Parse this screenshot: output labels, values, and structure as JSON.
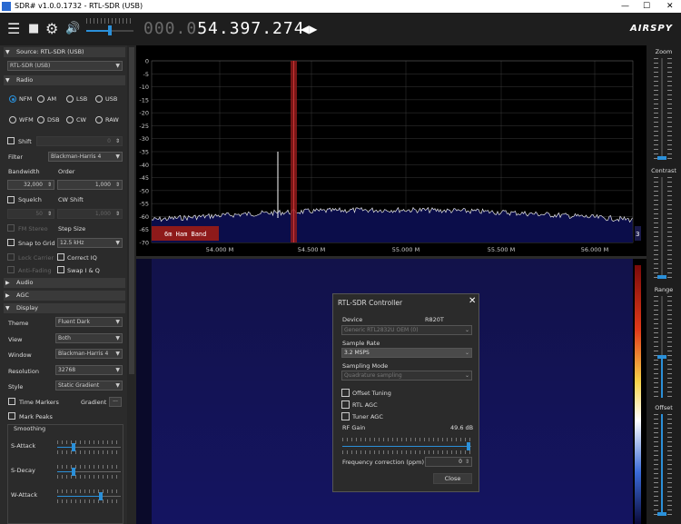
{
  "window": {
    "title": "SDR# v1.0.0.1732 - RTL-SDR (USB)",
    "minimize": "—",
    "maximize": "☐",
    "close": "✕"
  },
  "toolbar": {
    "frequency_dim": "000.0",
    "frequency_main": "54.397.274",
    "freq_arrows": "◀▶",
    "logo": "AIRSPY",
    "volume_percent": 50
  },
  "sidebar": {
    "source_header": "Source: RTL-SDR (USB)",
    "source_value": "RTL-SDR (USB)",
    "radio_header": "Radio",
    "modes": [
      "NFM",
      "AM",
      "LSB",
      "USB",
      "WFM",
      "DSB",
      "CW",
      "RAW"
    ],
    "selected_mode": "NFM",
    "shift_label": "Shift",
    "shift_value": "0",
    "filter_label": "Filter",
    "filter_value": "Blackman-Harris 4",
    "bandwidth_label": "Bandwidth",
    "bandwidth_value": "32,000",
    "order_label": "Order",
    "order_value": "1,000",
    "squelch_label": "Squelch",
    "squelch_value": "50",
    "cw_shift_label": "CW Shift",
    "cw_shift_value": "1,000",
    "fm_stereo_label": "FM Stereo",
    "step_size_label": "Step Size",
    "snap_label": "Snap to Grid",
    "step_value": "12.5 kHz",
    "lock_carrier_label": "Lock Carrier",
    "correct_iq_label": "Correct IQ",
    "anti_fading_label": "Anti-Fading",
    "swap_iq_label": "Swap I & Q",
    "audio_header": "Audio",
    "agc_header": "AGC",
    "display_header": "Display",
    "theme_label": "Theme",
    "theme_value": "Fluent Dark",
    "view_label": "View",
    "view_value": "Both",
    "window_label": "Window",
    "window_value": "Blackman-Harris 4",
    "resolution_label": "Resolution",
    "resolution_value": "32768",
    "style_label": "Style",
    "style_value": "Static Gradient",
    "time_markers_label": "Time Markers",
    "gradient_label": "Gradient",
    "gradient_btn": "...",
    "mark_peaks_label": "Mark Peaks",
    "smoothing_label": "Smoothing",
    "s_attack_label": "S-Attack",
    "s_decay_label": "S-Decay",
    "w_attack_label": "W-Attack"
  },
  "spectrum": {
    "y_ticks": [
      "0",
      "-5",
      "-10",
      "-15",
      "-20",
      "-25",
      "-30",
      "-35",
      "-40",
      "-45",
      "-50",
      "-55",
      "-60",
      "-65",
      "-70"
    ],
    "x_ticks": [
      "54.000 M",
      "54.500 M",
      "55.000 M",
      "55.500 M",
      "56.000 M"
    ],
    "band_label": "6m Ham Band",
    "side_value": "3"
  },
  "right_panel": {
    "zoom": "Zoom",
    "contrast": "Contrast",
    "range": "Range",
    "offset": "Offset"
  },
  "dialog": {
    "title": "RTL-SDR Controller",
    "close": "✕",
    "device_label": "Device",
    "device_tuner": "R820T",
    "device_value": "Generic RTL2832U OEM (0)",
    "sample_rate_label": "Sample Rate",
    "sample_rate_value": "3.2 MSPS",
    "sampling_mode_label": "Sampling Mode",
    "sampling_mode_value": "Quadrature sampling",
    "offset_tuning_label": "Offset Tuning",
    "rtl_agc_label": "RTL AGC",
    "tuner_agc_label": "Tuner AGC",
    "rf_gain_label": "RF Gain",
    "rf_gain_value": "49.6 dB",
    "freq_corr_label": "Frequency correction (ppm)",
    "freq_corr_value": "0",
    "close_button": "Close"
  },
  "colors": {
    "accent": "#2b90d9",
    "spectrum_fill": "#0b0d4a",
    "band_marker": "#8e1a1a"
  }
}
